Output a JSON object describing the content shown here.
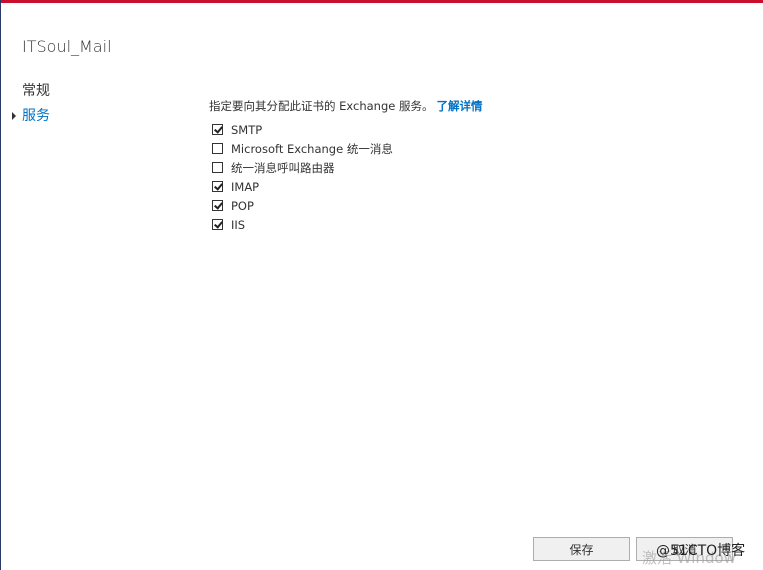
{
  "window": {
    "title": "ITSoul_Mail"
  },
  "nav": {
    "items": [
      {
        "label": "常规",
        "active": false
      },
      {
        "label": "服务",
        "active": true
      }
    ]
  },
  "main": {
    "description": "指定要向其分配此证书的 Exchange 服务。",
    "learn_more": "了解详情",
    "services": [
      {
        "label": "SMTP",
        "checked": true
      },
      {
        "label": "Microsoft Exchange 统一消息",
        "checked": false
      },
      {
        "label": "统一消息呼叫路由器",
        "checked": false
      },
      {
        "label": "IMAP",
        "checked": true
      },
      {
        "label": "POP",
        "checked": true
      },
      {
        "label": "IIS",
        "checked": true
      }
    ]
  },
  "footer": {
    "save_label": "保存",
    "cancel_label": "取消"
  },
  "overlay": {
    "activate_windows": "激活 Window",
    "blog_watermark": "@51CTO博客"
  },
  "colors": {
    "accent": "#0072c6",
    "top_bar": "#c8102e"
  }
}
